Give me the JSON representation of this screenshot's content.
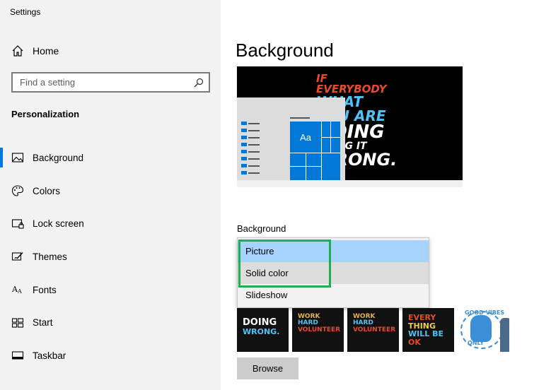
{
  "app": {
    "title": "Settings"
  },
  "sidebar": {
    "home_label": "Home",
    "search_placeholder": "Find a setting",
    "section_title": "Personalization",
    "items": [
      {
        "label": "Background",
        "icon": "picture-icon",
        "active": true
      },
      {
        "label": "Colors",
        "icon": "palette-icon"
      },
      {
        "label": "Lock screen",
        "icon": "lock-screen-icon"
      },
      {
        "label": "Themes",
        "icon": "themes-icon"
      },
      {
        "label": "Fonts",
        "icon": "fonts-icon"
      },
      {
        "label": "Start",
        "icon": "start-icon"
      },
      {
        "label": "Taskbar",
        "icon": "taskbar-icon"
      }
    ]
  },
  "main": {
    "page_title": "Background",
    "preview": {
      "tile_label": "Aa",
      "poster_lines": [
        "IF EVERYBODY",
        "WHAT YOU ARE",
        "DOING",
        "DOING IT",
        "WRONG."
      ]
    },
    "background_label": "Background",
    "dropdown": {
      "options": [
        "Picture",
        "Solid color",
        "Slideshow"
      ],
      "hovered": "Picture"
    },
    "thumbnails": [
      {
        "lines": [
          "DOING",
          "WRONG."
        ]
      },
      {
        "lines": [
          "WORK",
          "HARD",
          "VOLUNTEER"
        ]
      },
      {
        "lines": [
          "WORK",
          "HARD",
          "VOLUNTEER"
        ]
      },
      {
        "lines": [
          "EVERY",
          "THING",
          "WILL BE",
          "OK"
        ]
      },
      {
        "lines": [
          "GOOD VIBES",
          "ONLY"
        ]
      }
    ],
    "browse_label": "Browse"
  },
  "colors": {
    "accent": "#0078d7",
    "highlight_box": "#1fae4e",
    "hover": "#a6d3ff"
  }
}
